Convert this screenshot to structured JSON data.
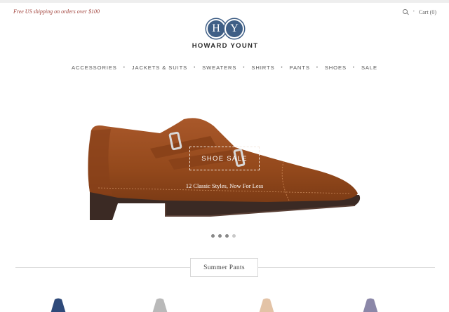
{
  "header": {
    "promo": "Free US shipping on orders over $100",
    "cart": "Cart (0)",
    "separator": "•"
  },
  "logo": {
    "left_letter": "H",
    "right_letter": "Y",
    "brand": "HOWARD YOUNT"
  },
  "nav": {
    "items": [
      "ACCESSORIES",
      "JACKETS & SUITS",
      "SWEATERS",
      "SHIRTS",
      "PANTS",
      "SHOES",
      "SALE"
    ],
    "separator": "•"
  },
  "hero": {
    "title": "SHOE SALE",
    "subtitle": "12 Classic Styles, Now For Less",
    "slides": 4,
    "active_slide": 1
  },
  "section": {
    "label": "Summer Pants"
  },
  "colors": {
    "brand_blue": "#3f5f86",
    "promo_red": "#a0413a",
    "suede": "#9b4f22",
    "pant_navy": "#2f4a7a",
    "pant_grey": "#b9b9b9",
    "pant_tan": "#e3c3a6",
    "pant_lilac": "#8b87a8"
  }
}
